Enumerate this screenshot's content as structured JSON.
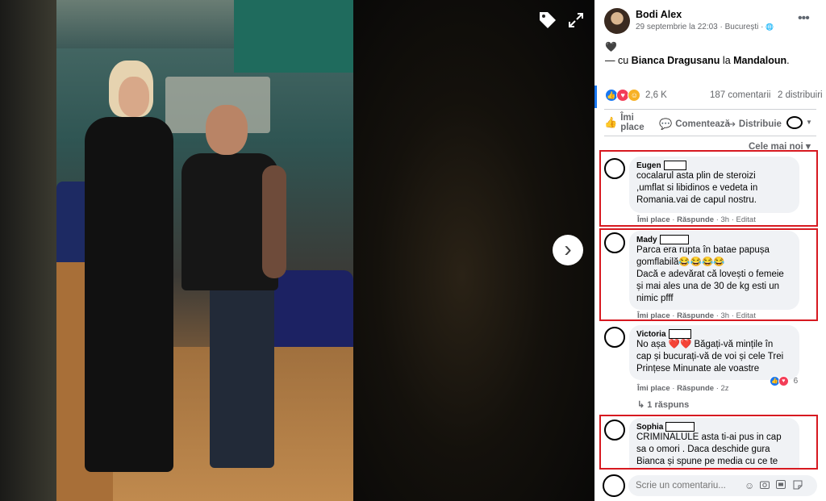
{
  "viewer": {
    "tag_icon": "tag-icon",
    "expand_icon": "expand-icon",
    "next_icon": "chevron-right-icon",
    "next_glyph": "›"
  },
  "post": {
    "author": "Bodi Alex",
    "date": "29 septembrie la 22:03",
    "separator": "·",
    "location": "București",
    "privacy_glyph": "🌐",
    "more_glyph": "•••",
    "emoji": "🖤",
    "with_prefix": "— cu",
    "with_person": "Bianca Dragusanu",
    "at_word": "la",
    "place": "Mandaloun",
    "period": "."
  },
  "stats": {
    "reaction_count": "2,6 K",
    "comments": "187 comentarii",
    "shares": "2 distribuiri"
  },
  "actions": {
    "like_label": "Îmi place",
    "comment_label": "Comentează",
    "share_label": "Distribuie",
    "like_glyph": "👍",
    "comment_glyph": "💬",
    "share_glyph": "↪",
    "caret_glyph": "▼"
  },
  "sort": {
    "label": "Cele mai noi",
    "caret": "▾"
  },
  "comments": [
    {
      "name": "Eugen",
      "lines": [
        "cocalarul asta plin de steroizi",
        ",umflat si libidinos e vedeta in",
        "Romania.vai de capul nostru."
      ],
      "like": "Îmi place",
      "reply": "Răspunde",
      "time": "3h",
      "edited": "Editat"
    },
    {
      "name": "Mady",
      "lines": [
        "Parca era rupta în bataе papușa",
        "gomflabilă😂😂😂😂",
        "Dacă e adevărat că lovești o femeie",
        "și mai ales una de 30 de kg esti un",
        "nimic pfff"
      ],
      "like": "Îmi place",
      "reply": "Răspunde",
      "time": "3h",
      "edited": "Editat"
    },
    {
      "name": "Victoria",
      "lines": [
        "No așa ❤️❤️ Băgați-vă mințile în",
        "cap și bucurați-vă de voi și cele Trei",
        "Prințese Minunate ale voastre"
      ],
      "like": "Îmi place",
      "reply": "Răspunde",
      "time": "2z",
      "reaction_count": "6",
      "replies": "1 răspuns",
      "reply_glyph": "↳"
    },
    {
      "name": "Sophia",
      "lines": [
        "CRIMINALULE asta ti-ai pus in cap",
        "sa o omori . Daca deschide gura",
        "Bianca și spune pe media cu ce te"
      ]
    }
  ],
  "write": {
    "placeholder": "Scrie un comentariu...",
    "icons": [
      "emoji-icon",
      "camera-icon",
      "gif-icon",
      "sticker-icon"
    ]
  },
  "colors": {
    "highlight_border": "#d71920",
    "facebook_blue": "#1877f2"
  }
}
